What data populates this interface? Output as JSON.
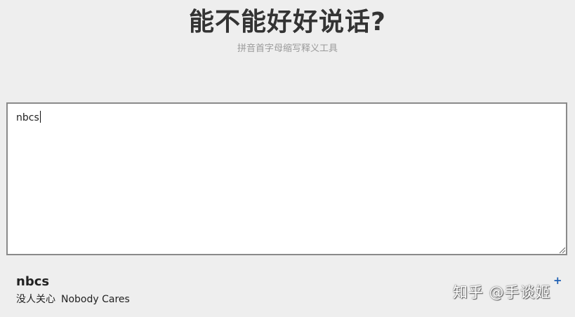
{
  "header": {
    "title": "能不能好好说话?",
    "subtitle": "拼音首字母缩写释义工具"
  },
  "input": {
    "value": "nbcs"
  },
  "results": [
    {
      "abbr": "nbcs",
      "meaning_zh": "没人关心",
      "meaning_en": "Nobody Cares"
    }
  ],
  "icons": {
    "add": "plus-icon",
    "resize": "resize-grip-icon"
  },
  "watermark": {
    "text": "知乎 @手谈姬"
  },
  "colors": {
    "background": "#eeeeee",
    "accent": "#1e5fb3",
    "subtitle": "#9a9a9a"
  }
}
